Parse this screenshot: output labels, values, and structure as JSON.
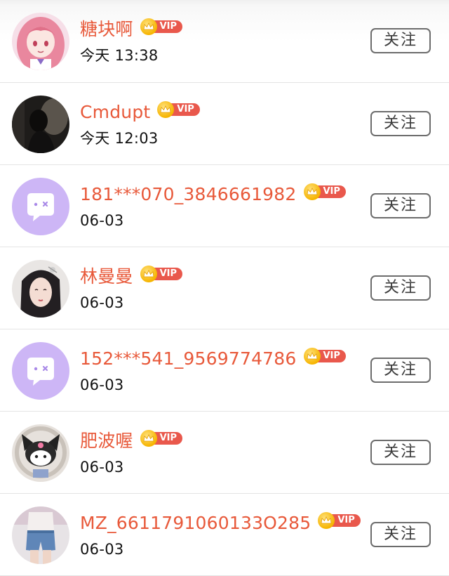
{
  "follow_list": {
    "items": [
      {
        "name": "糖块啊",
        "vip_label": "VIP",
        "time": "今天 13:38",
        "follow_label": "关注",
        "avatar": "anime-girl-pink-hair-avatar"
      },
      {
        "name": "Cmdupt",
        "vip_label": "VIP",
        "time": "今天 12:03",
        "follow_label": "关注",
        "avatar": "dark-silhouette-photo-avatar"
      },
      {
        "name": "181***070_3846661982",
        "vip_label": "VIP",
        "time": "06-03",
        "follow_label": "关注",
        "avatar": "default-purple-chat-avatar"
      },
      {
        "name": "林曼曼",
        "vip_label": "VIP",
        "time": "06-03",
        "follow_label": "关注",
        "avatar": "illustrated-woman-avatar"
      },
      {
        "name": "152***541_9569774786",
        "vip_label": "VIP",
        "time": "06-03",
        "follow_label": "关注",
        "avatar": "default-purple-chat-avatar"
      },
      {
        "name": "肥波喔",
        "vip_label": "VIP",
        "time": "06-03",
        "follow_label": "关注",
        "avatar": "kuromi-toy-avatar"
      },
      {
        "name": "MZ_6611791060133O285",
        "vip_label": "VIP",
        "time": "06-03",
        "follow_label": "关注",
        "avatar": "denim-shorts-photo-avatar"
      }
    ]
  },
  "colors": {
    "name": "#e8593a",
    "vip_badge": "#e9584c",
    "crown": "#f6b400",
    "default_avatar": "#cdb6f6"
  }
}
